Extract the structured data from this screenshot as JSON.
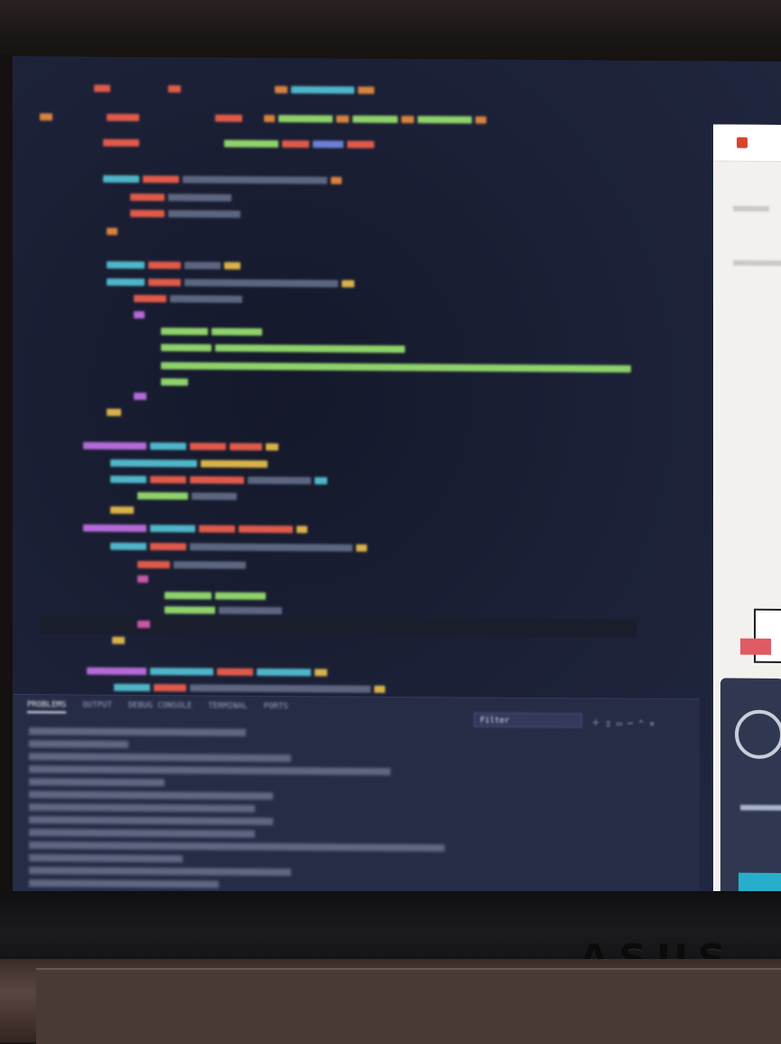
{
  "panel": {
    "tabs": [
      {
        "label": "PROBLEMS"
      },
      {
        "label": "OUTPUT"
      },
      {
        "label": "DEBUG CONSOLE"
      },
      {
        "label": "TERMINAL"
      },
      {
        "label": "PORTS"
      }
    ],
    "filter_value": "Filter"
  },
  "brand": {
    "label": "ASUS"
  },
  "colors": {
    "editor_bg": "#1b2036",
    "panel_bg": "#262c45",
    "string": "#8fd26a",
    "keyword": "#e05a4a",
    "identifier": "#4fb6c9",
    "accent_button": "#27aecb"
  },
  "icons": {
    "panel_controls": [
      "plus-icon",
      "split-icon",
      "trash-icon",
      "ellipsis-icon",
      "chevron-up-icon",
      "close-icon"
    ]
  }
}
